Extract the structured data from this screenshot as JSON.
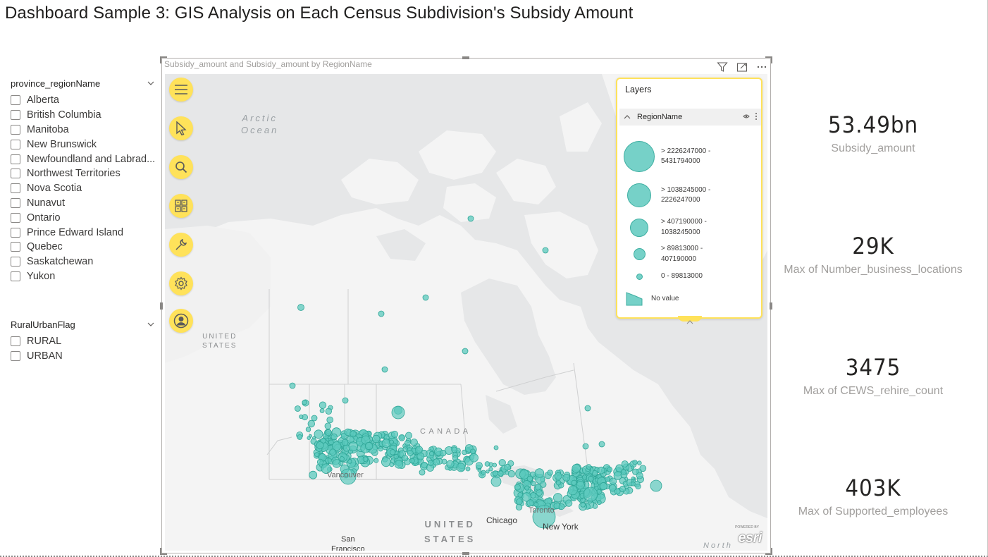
{
  "report": {
    "title": "Dashboard Sample 3: GIS Analysis on Each Census Subdivision's Subsidy Amount"
  },
  "slicers": {
    "province": {
      "title": "province_regionName",
      "items": [
        "Alberta",
        "British Columbia",
        "Manitoba",
        "New Brunswick",
        "Newfoundland and Labrad...",
        "Northwest Territories",
        "Nova Scotia",
        "Nunavut",
        "Ontario",
        "Prince Edward Island",
        "Quebec",
        "Saskatchewan",
        "Yukon"
      ]
    },
    "rural_urban": {
      "title": "RuralUrbanFlag",
      "items": [
        "RURAL",
        "URBAN"
      ]
    }
  },
  "map_visual": {
    "title": "Subsidy_amount and Subsidy_amount by RegionName",
    "toolbar": {
      "icons": [
        "filter-icon",
        "focus-mode-icon",
        "more-options-icon"
      ]
    },
    "tools": [
      "menu-icon",
      "select-pointer-icon",
      "search-icon",
      "basemap-gallery-icon",
      "analysis-tools-icon",
      "settings-icon",
      "account-icon"
    ],
    "map_labels": {
      "arctic_ocean": "Arctic\nOcean",
      "united_states_nw": "UNITED\nSTATES",
      "canada": "C A N A D A",
      "united_states_main": "UNITED\nSTATES",
      "chicago": "Chicago",
      "new_york": "New York",
      "san_francisco": "San\nFrancisco",
      "vancouver": "Vancouver",
      "toronto": "Toronto",
      "north": "North"
    },
    "attribution": {
      "powered_by": "POWERED BY",
      "logo": "esri"
    },
    "layers_panel": {
      "title": "Layers",
      "layer_name": "RegionName",
      "legend": [
        {
          "label_line1": "> 2226247000 -",
          "label_line2": "5431794000"
        },
        {
          "label_line1": "> 1038245000 -",
          "label_line2": "2226247000"
        },
        {
          "label_line1": "> 407190000 -",
          "label_line2": "1038245000"
        },
        {
          "label_line1": "> 89813000 -",
          "label_line2": "407190000"
        },
        {
          "label_line1": "0 - 89813000",
          "label_line2": ""
        },
        {
          "label_line1": "No value",
          "label_line2": ""
        }
      ]
    },
    "colors": {
      "bubble_fill": "#5cc9bd",
      "bubble_stroke": "#2fa697",
      "tool_accent": "#ffe25a",
      "land": "#f4f4f4",
      "water": "#e6e7e8"
    }
  },
  "kpis": [
    {
      "value": "53.49bn",
      "label": "Subsidy_amount"
    },
    {
      "value": "29K",
      "label": "Max of Number_business_locations"
    },
    {
      "value": "3475",
      "label": "Max of CEWS_rehire_count"
    },
    {
      "value": "403K",
      "label": "Max of Supported_employees"
    }
  ]
}
